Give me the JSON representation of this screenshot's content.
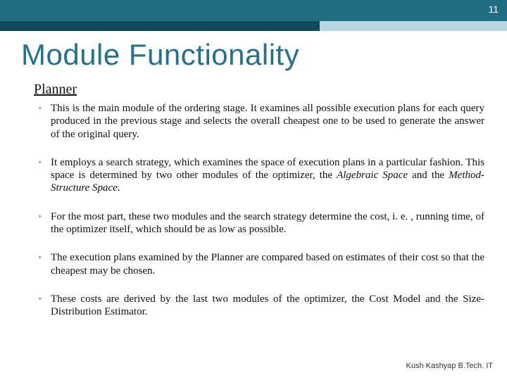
{
  "page_number": "11",
  "title": "Module Functionality",
  "subtitle": "Planner",
  "bullets": [
    "This is the main module of the ordering stage. It examines all possible execution plans for each query produced in the previous stage and selects the overall cheapest one to be used to generate the answer of the original query.",
    "It employs a search strategy, which examines the space of execution plans in a particular fashion. This space is determined by two other modules of the optimizer, the Algebraic Space and the Method-Structure Space.",
    "For the most part, these two modules and the search strategy determine the cost, i. e. , running time, of the optimizer itself, which should be as low as possible.",
    "The execution plans examined by the Planner are compared based on estimates of their cost so that the cheapest may be chosen.",
    "These costs are derived by the last two modules of the optimizer, the Cost Model and the Size-Distribution Estimator."
  ],
  "footer": "Kush Kashyap B.Tech. IT",
  "colors": {
    "header": "#1f6d81",
    "title": "#26708a",
    "bullet_glyph": "#9fb7bf"
  }
}
